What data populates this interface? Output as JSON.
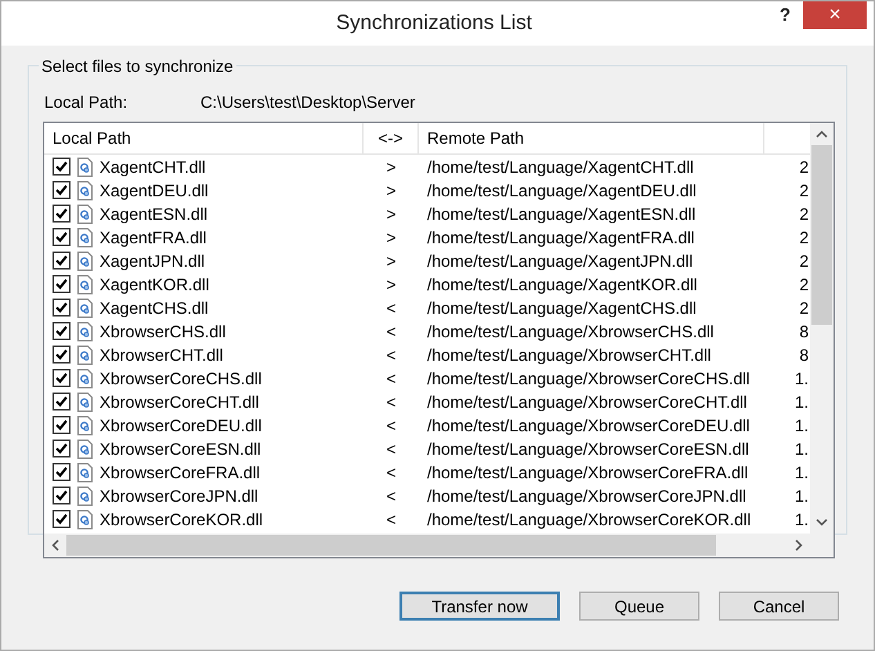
{
  "window": {
    "title": "Synchronizations List",
    "help": "?",
    "close": "×"
  },
  "group": {
    "legend": "Select files to synchronize",
    "local_path_label": "Local Path:",
    "local_path_value": "C:\\Users\\test\\Desktop\\Server"
  },
  "table": {
    "columns": [
      "Local Path",
      "<->",
      "Remote Path"
    ],
    "rows": [
      {
        "checked": true,
        "local": "XagentCHT.dll",
        "direction": ">",
        "remote": "/home/test/Language/XagentCHT.dll",
        "column_4": "2"
      },
      {
        "checked": true,
        "local": "XagentDEU.dll",
        "direction": ">",
        "remote": "/home/test/Language/XagentDEU.dll",
        "column_4": "2"
      },
      {
        "checked": true,
        "local": "XagentESN.dll",
        "direction": ">",
        "remote": "/home/test/Language/XagentESN.dll",
        "column_4": "2"
      },
      {
        "checked": true,
        "local": "XagentFRA.dll",
        "direction": ">",
        "remote": "/home/test/Language/XagentFRA.dll",
        "column_4": "2"
      },
      {
        "checked": true,
        "local": "XagentJPN.dll",
        "direction": ">",
        "remote": "/home/test/Language/XagentJPN.dll",
        "column_4": "2"
      },
      {
        "checked": true,
        "local": "XagentKOR.dll",
        "direction": ">",
        "remote": "/home/test/Language/XagentKOR.dll",
        "column_4": "2"
      },
      {
        "checked": true,
        "local": "XagentCHS.dll",
        "direction": "<",
        "remote": "/home/test/Language/XagentCHS.dll",
        "column_4": "2"
      },
      {
        "checked": true,
        "local": "XbrowserCHS.dll",
        "direction": "<",
        "remote": "/home/test/Language/XbrowserCHS.dll",
        "column_4": "8"
      },
      {
        "checked": true,
        "local": "XbrowserCHT.dll",
        "direction": "<",
        "remote": "/home/test/Language/XbrowserCHT.dll",
        "column_4": "8"
      },
      {
        "checked": true,
        "local": "XbrowserCoreCHS.dll",
        "direction": "<",
        "remote": "/home/test/Language/XbrowserCoreCHS.dll",
        "column_4": "1."
      },
      {
        "checked": true,
        "local": "XbrowserCoreCHT.dll",
        "direction": "<",
        "remote": "/home/test/Language/XbrowserCoreCHT.dll",
        "column_4": "1."
      },
      {
        "checked": true,
        "local": "XbrowserCoreDEU.dll",
        "direction": "<",
        "remote": "/home/test/Language/XbrowserCoreDEU.dll",
        "column_4": "1."
      },
      {
        "checked": true,
        "local": "XbrowserCoreESN.dll",
        "direction": "<",
        "remote": "/home/test/Language/XbrowserCoreESN.dll",
        "column_4": "1."
      },
      {
        "checked": true,
        "local": "XbrowserCoreFRA.dll",
        "direction": "<",
        "remote": "/home/test/Language/XbrowserCoreFRA.dll",
        "column_4": "1."
      },
      {
        "checked": true,
        "local": "XbrowserCoreJPN.dll",
        "direction": "<",
        "remote": "/home/test/Language/XbrowserCoreJPN.dll",
        "column_4": "1."
      },
      {
        "checked": true,
        "local": "XbrowserCoreKOR.dll",
        "direction": "<",
        "remote": "/home/test/Language/XbrowserCoreKOR.dll",
        "column_4": "1."
      }
    ]
  },
  "buttons": [
    {
      "label": "Transfer now",
      "default": true
    },
    {
      "label": "Queue",
      "default": false
    },
    {
      "label": "Cancel",
      "default": false
    }
  ]
}
